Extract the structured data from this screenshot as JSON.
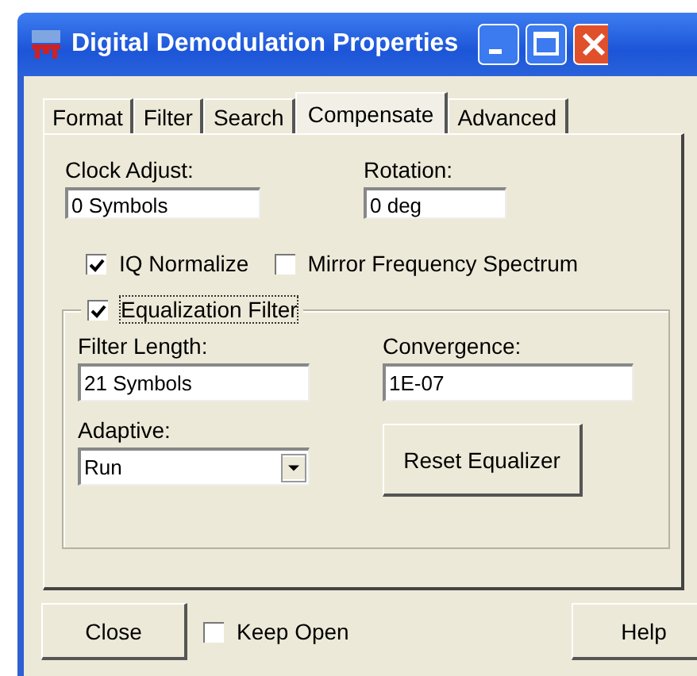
{
  "window": {
    "title": "Digital Demodulation Properties"
  },
  "tabs": [
    {
      "label": "Format",
      "selected": false
    },
    {
      "label": "Filter",
      "selected": false
    },
    {
      "label": "Search",
      "selected": false
    },
    {
      "label": "Compensate",
      "selected": true
    },
    {
      "label": "Advanced",
      "selected": false
    }
  ],
  "fields": [
    {
      "label": "Clock Adjust:",
      "value": "0 Symbols"
    },
    {
      "label": "Rotation:",
      "value": "0 deg"
    }
  ],
  "options": [
    {
      "label": "IQ Normalize",
      "checked": true
    },
    {
      "label": "Mirror Frequency Spectrum",
      "checked": false
    }
  ],
  "equalization": {
    "label": "Equalization Filter",
    "checked": true,
    "fields": [
      {
        "label": "Filter Length:",
        "value": "21 Symbols"
      },
      {
        "label": "Convergence:",
        "value": "1E-07"
      }
    ],
    "adaptive": {
      "label": "Adaptive:",
      "value": "Run"
    },
    "reset_button": "Reset Equalizer"
  },
  "footer": {
    "close_button": "Close",
    "keep_open": {
      "label": "Keep Open",
      "checked": false
    },
    "help_button": "Help"
  }
}
